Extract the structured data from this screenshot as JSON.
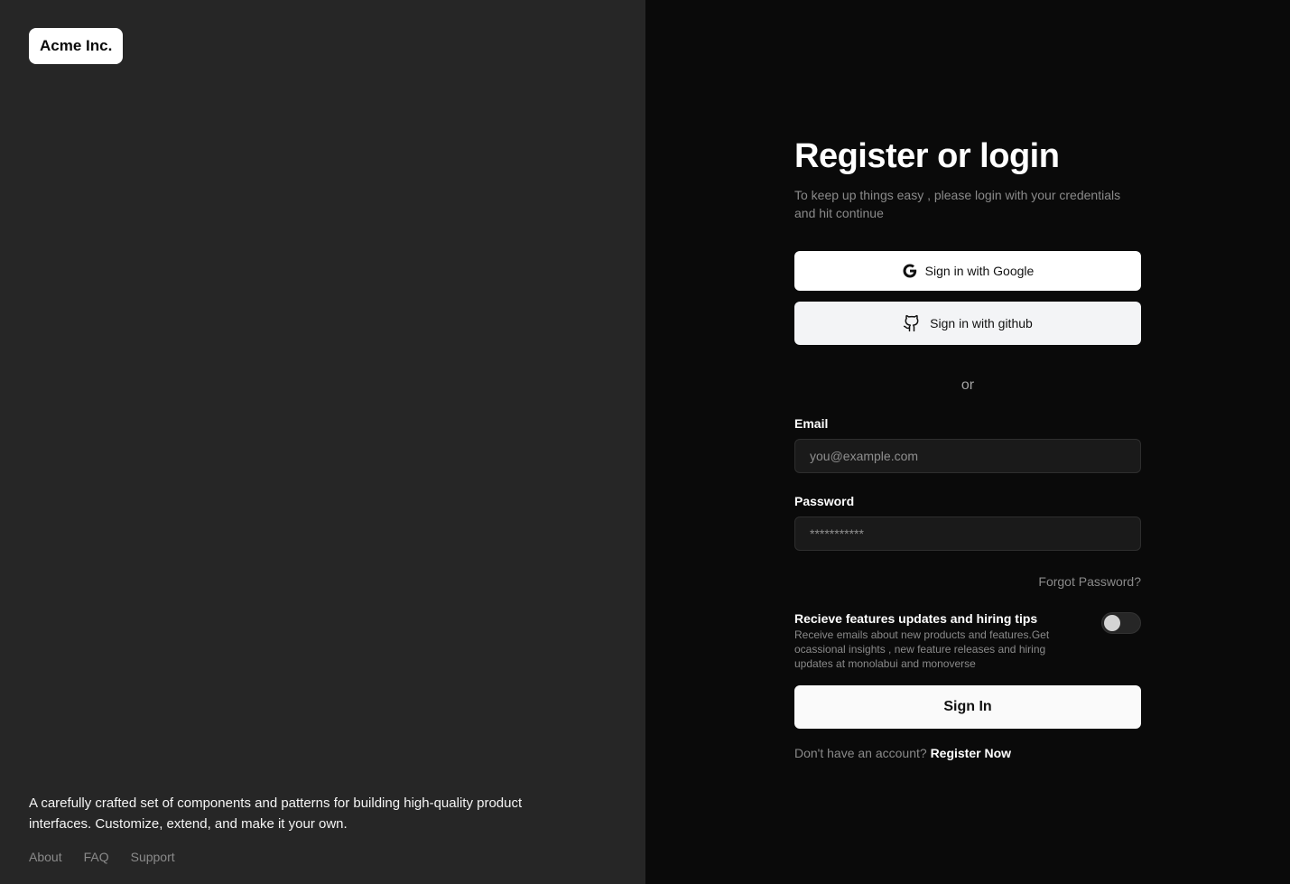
{
  "brand": {
    "logo_text": "Acme Inc."
  },
  "left_panel": {
    "tagline": "A carefully crafted set of components and patterns for building high-quality product interfaces. Customize, extend, and make it your own.",
    "footer_links": [
      "About",
      "FAQ",
      "Support"
    ]
  },
  "form": {
    "title": "Register or login",
    "subtitle": "To keep up things easy , please login with your credentials and hit continue",
    "google_button": "Sign in with Google",
    "github_button": "Sign in with github",
    "divider": "or",
    "email_label": "Email",
    "email_placeholder": "you@example.com",
    "password_label": "Password",
    "password_placeholder": "***********",
    "forgot_password": "Forgot Password?",
    "updates_title": "Recieve features updates and hiring tips",
    "updates_description": "Receive emails about new products and features.Get ocassional insights , new feature releases and hiring updates at monolabui and monoverse",
    "updates_toggle_on": false,
    "signin_button": "Sign In",
    "no_account_text": "Don't have an account?",
    "register_link": "Register Now"
  },
  "icons": {
    "google": "google-icon",
    "github": "github-icon"
  }
}
